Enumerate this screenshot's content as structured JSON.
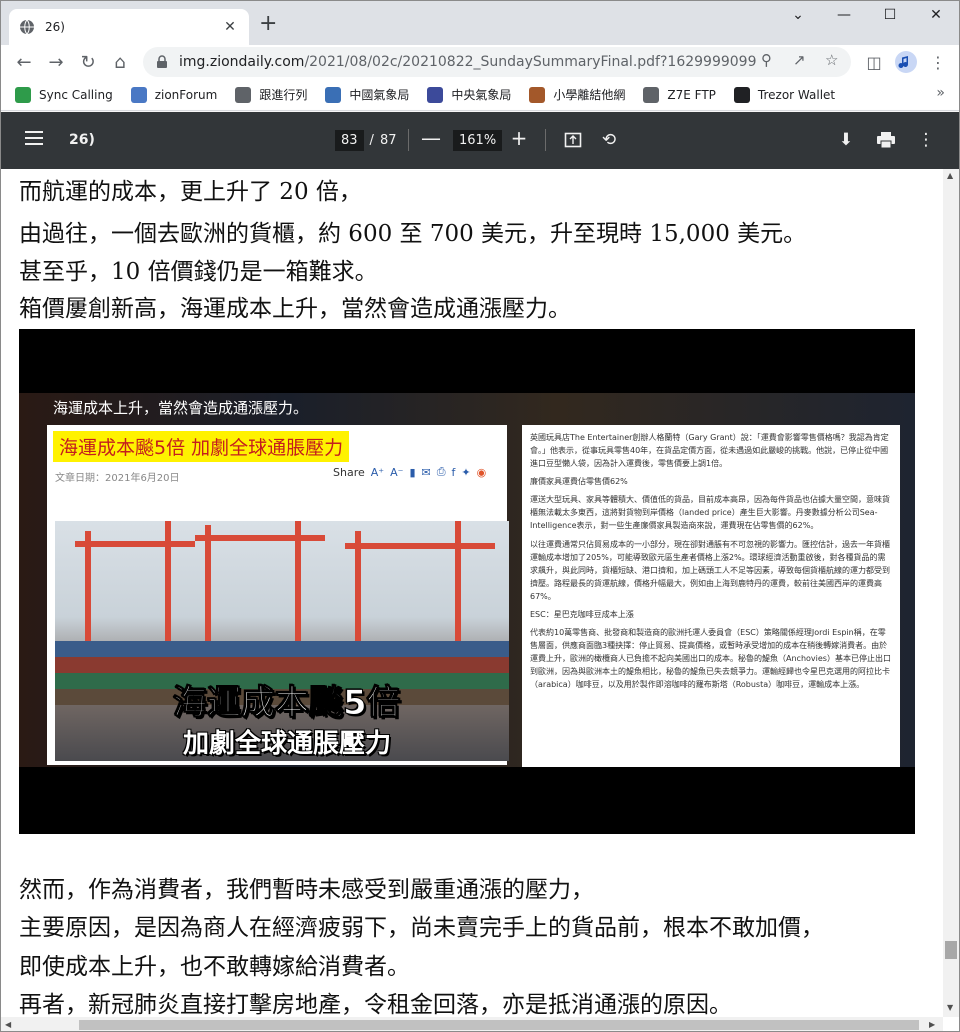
{
  "browser": {
    "tab_title": "26)",
    "tab_close": "✕",
    "new_tab": "+",
    "window_controls": {
      "minimize": "—",
      "maximize": "☐",
      "close": "✕",
      "tab_list": "⌄"
    },
    "url_host": "img.ziondaily.com",
    "url_path": "/2021/08/02c/20210822_SundaySummaryFinal.pdf?1629999099",
    "bookmarks": [
      {
        "label": "Sync Calling",
        "color": "#2e9b4a"
      },
      {
        "label": "zionForum",
        "color": "#4a78c4"
      },
      {
        "label": "跟進行列",
        "color": "#5f6368"
      },
      {
        "label": "中國氣象局",
        "color": "#3a6fb5"
      },
      {
        "label": "中央氣象局",
        "color": "#3c4a9a"
      },
      {
        "label": "小學離結他網",
        "color": "#a3582a"
      },
      {
        "label": "Z7E FTP",
        "color": "#5f6368"
      },
      {
        "label": "Trezor Wallet",
        "color": "#202124"
      }
    ],
    "bookmarks_more": "»"
  },
  "pdf": {
    "title": "26)",
    "current_page": "83",
    "page_separator": "/",
    "total_pages": "87",
    "zoom": "161%",
    "zoom_out": "—",
    "zoom_in": "+"
  },
  "content": {
    "lines_top": [
      "而航運的成本，更上升了 20 倍，",
      "由過往，一個去歐洲的貨櫃，約 600 至 700 美元，升至現時 15,000 美元。",
      "甚至乎，10 倍價錢仍是一箱難求。",
      "箱價屢創新高，海運成本上升，當然會造成通漲壓力。"
    ],
    "video": {
      "caption": "海運成本上升，當然會造成通漲壓力。",
      "article_title": "海運成本飈5倍 加劇全球通脹壓力",
      "article_date": "文章日期：2021年6月20日",
      "share_label": "Share",
      "headline_line1": "海運成本飈5倍",
      "headline_line2": "加劇全球通脹壓力",
      "panel": [
        "英國玩具店The Entertainer創辦人格蘭特（Gary Grant）說：「運費會影響零售價格嗎？我認為肯定會。」他表示，從事玩具零售40年，在貨品定價方面，從未遇過如此嚴峻的挑戰。他說，已停止從中國進口豆型懶人袋，因為計入運費後，零售價要上調1倍。",
        "廉價家具運費佔零售價62%",
        "運送大型玩具、家具等體積大、價值低的貨品，目前成本高昂，因為每件貨品也佔據大量空間，意味貨櫃無法載太多東西，這將對貨物到岸價格（landed price）產生巨大影響。丹麥數據分析公司Sea-Intelligence表示，對一些生產廉價家具製造商來說，運費現在佔零售價的62%。",
        "以往運費通常只佔貿易成本的一小部分，現在卻對通脹有不可忽視的影響力。匯控估計，過去一年貨櫃運輸成本增加了205%，可能導致歐元區生產者價格上漲2%。環球經濟活動重啟後，對各種貨品的需求飆升，與此同時，貨櫃短缺、港口擠和，加上碼頭工人不足等因素，導致每個貨櫃航線的運力都受到擠壓。路程最長的貨運航線，價格升幅最大，例如由上海到鹿特丹的運費，較前往美國西岸的運費高67%。",
        "ESC：星巴克咖啡豆成本上漲",
        "代表約10萬零售商、批發商和製造商的歐洲托運人委員會（ESC）策略關係經理Jordi Espin稱，在零售層面，供應商面臨3種抉擇：停止貿易、提高價格，或暫時承受增加的成本在稍後轉嫁消費者。由於運費上升，歐洲的橄欖商人已負擔不起向美國出口的成本。秘魯的鯷魚（Anchovies）基本已停止出口到歐洲，因為與歐洲本土的鯷魚相比，秘魯的鯷魚已失去競爭力。運輸經歸也令星巴克選用的阿拉比卡（arabica）咖啡豆，以及用於製作即溶咖啡的羅布斯塔（Robusta）咖啡豆，運輸成本上漲。"
      ]
    },
    "lines_bottom": [
      "然而，作為消費者，我們暫時未感受到嚴重通漲的壓力，",
      "主要原因，是因為商人在經濟疲弱下，尚未賣完手上的貨品前，根本不敢加價，",
      "即使成本上升，也不敢轉嫁給消費者。",
      "再者，新冠肺炎直接打擊房地產，令租金回落，亦是抵消通漲的原因。"
    ]
  }
}
